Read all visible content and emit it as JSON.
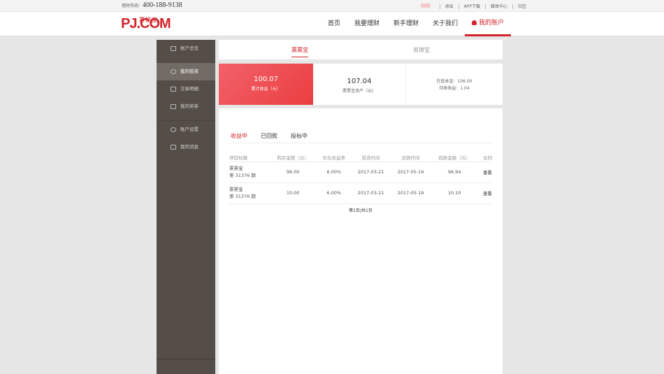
{
  "topbar": {
    "hotline_label": "理财热线：",
    "hotline_number": "400-188-9138",
    "links": [
      "退出",
      "APP下载",
      "媒体中心",
      "社区"
    ]
  },
  "header": {
    "logo_text": "PJ.COM",
    "logo_cn": "票据宝",
    "nav": [
      "首页",
      "我要理财",
      "新手理财",
      "关于我们",
      "我的账户"
    ]
  },
  "sidebar": {
    "items": [
      "账户总览",
      "我的投资",
      "交易明细",
      "我的奖券",
      "账户设置",
      "我的消息"
    ]
  },
  "product_tabs": [
    "票票宝",
    "易铸宝"
  ],
  "stats": {
    "cumulative_value": "100.07",
    "cumulative_label": "累计收益（元）",
    "assets_value": "107.04",
    "assets_label": "票票宝资产（元）",
    "principal": "在投本金：106.00",
    "pending": "待收收益：1.04"
  },
  "sub_tabs": [
    "收益中",
    "已回款",
    "投标中"
  ],
  "table": {
    "headers": [
      "项目标题",
      "购买金额（元）",
      "年化收益率",
      "投资时间",
      "还款时间",
      "回款金额（元）",
      "合同"
    ],
    "rows": [
      {
        "name1": "票票宝",
        "name2": "第 31376 期",
        "amount": "96.00",
        "rate": "6.00%",
        "invest": "2017-03-21",
        "repay": "2017-05-19",
        "return": "96.94",
        "link": "查看"
      },
      {
        "name1": "票票宝",
        "name2": "第 31376 期",
        "amount": "10.00",
        "rate": "6.00%",
        "invest": "2017-03-21",
        "repay": "2017-05-19",
        "return": "10.10",
        "link": "查看"
      }
    ]
  },
  "pager": "第1页/共1页",
  "colors": {
    "brand": "#d3232b",
    "sidebar": "#544d48"
  }
}
